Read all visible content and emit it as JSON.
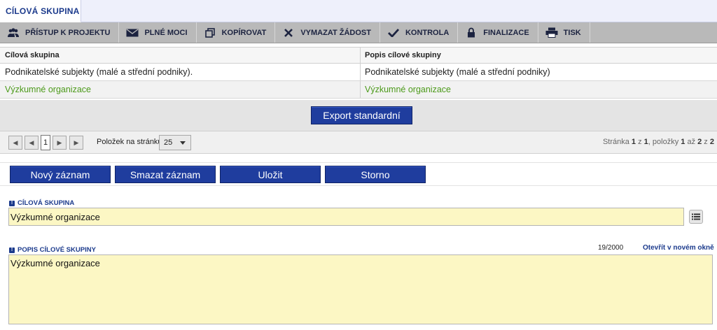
{
  "tab": {
    "title": "CÍLOVÁ SKUPINA"
  },
  "toolbar": [
    {
      "label": "PŘÍSTUP K PROJEKTU",
      "icon": "users-icon"
    },
    {
      "label": "PLNÉ MOCI",
      "icon": "envelope-icon"
    },
    {
      "label": "KOPÍROVAT",
      "icon": "copy-icon"
    },
    {
      "label": "VYMAZAT ŽÁDOST",
      "icon": "x-icon"
    },
    {
      "label": "KONTROLA",
      "icon": "check-icon"
    },
    {
      "label": "FINALIZACE",
      "icon": "lock-icon"
    },
    {
      "label": "TISK",
      "icon": "printer-icon"
    }
  ],
  "grid": {
    "columns": [
      "Cílová skupina",
      "Popis cílové skupiny"
    ],
    "rows": [
      [
        "Podnikatelské subjekty (malé a střední podniky).",
        "Podnikatelské subjekty (malé a střední podniky)"
      ],
      [
        "Výzkumné organizace",
        "Výzkumné organizace"
      ]
    ],
    "selected_row": 1
  },
  "export": {
    "label": "Export standardní"
  },
  "pager": {
    "current_page": "1",
    "per_page_label": "Položek na stránku",
    "per_page_value": "25",
    "info_prefix": "Stránka ",
    "page": "1",
    "info_z": " z ",
    "pages": "1",
    "info_items": ", položky ",
    "from": "1",
    "info_az": " až ",
    "to": "2",
    "info_z2": " z ",
    "total": "2"
  },
  "actions": {
    "new": "Nový záznam",
    "delete": "Smazat záznam",
    "save": "Uložit",
    "cancel": "Storno"
  },
  "form": {
    "group_label": "CÍLOVÁ SKUPINA",
    "group_value": "Výzkumné organizace",
    "desc_label": "POPIS CÍLOVÉ SKUPINY",
    "desc_value": "Výzkumné organizace",
    "counter": "19/2000",
    "open_new_window": "Otevřít v novém okně"
  },
  "colors": {
    "accent": "#1f3d9e",
    "selected_text": "#4c9a1a",
    "field_bg": "#fcf7c4"
  }
}
